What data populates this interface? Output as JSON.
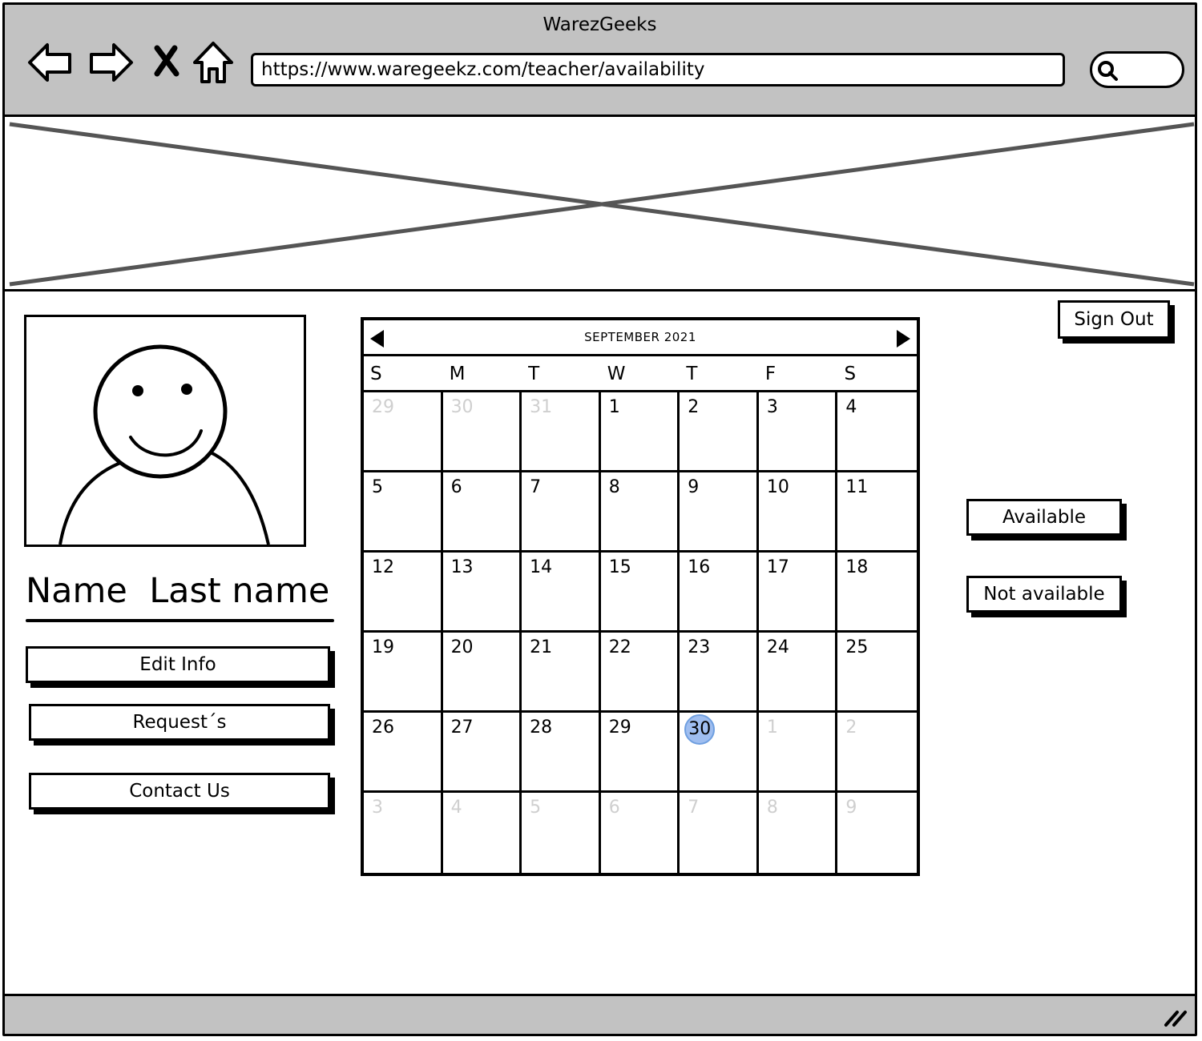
{
  "window": {
    "title": "WarezGeeks"
  },
  "browser": {
    "url": "https://www.waregeekz.com/teacher/availability",
    "nav_icons": [
      "back-arrow-icon",
      "forward-arrow-icon",
      "close-x-icon",
      "home-icon"
    ],
    "search_icon": "search-icon"
  },
  "banner": {
    "type": "image-placeholder"
  },
  "profile": {
    "avatar_icon": "user-avatar-icon",
    "name": "Name  Last name",
    "buttons": {
      "edit": "Edit Info",
      "requests": "Request´s",
      "contact": "Contact Us"
    }
  },
  "calendar": {
    "month_label": "SEPTEMBER 2021",
    "weekdays": [
      "S",
      "M",
      "T",
      "W",
      "T",
      "F",
      "S"
    ],
    "today": "30",
    "weeks": [
      [
        {
          "d": "29",
          "o": true
        },
        {
          "d": "30",
          "o": true
        },
        {
          "d": "31",
          "o": true
        },
        {
          "d": "1"
        },
        {
          "d": "2"
        },
        {
          "d": "3"
        },
        {
          "d": "4"
        }
      ],
      [
        {
          "d": "5"
        },
        {
          "d": "6"
        },
        {
          "d": "7"
        },
        {
          "d": "8"
        },
        {
          "d": "9"
        },
        {
          "d": "10"
        },
        {
          "d": "11"
        }
      ],
      [
        {
          "d": "12"
        },
        {
          "d": "13"
        },
        {
          "d": "14"
        },
        {
          "d": "15"
        },
        {
          "d": "16"
        },
        {
          "d": "17"
        },
        {
          "d": "18"
        }
      ],
      [
        {
          "d": "19"
        },
        {
          "d": "20"
        },
        {
          "d": "21"
        },
        {
          "d": "22"
        },
        {
          "d": "23"
        },
        {
          "d": "24"
        },
        {
          "d": "25"
        }
      ],
      [
        {
          "d": "26"
        },
        {
          "d": "27"
        },
        {
          "d": "28"
        },
        {
          "d": "29"
        },
        {
          "d": "30",
          "today": true
        },
        {
          "d": "1",
          "o": true
        },
        {
          "d": "2",
          "o": true
        }
      ],
      [
        {
          "d": "3",
          "o": true
        },
        {
          "d": "4",
          "o": true
        },
        {
          "d": "5",
          "o": true
        },
        {
          "d": "6",
          "o": true
        },
        {
          "d": "7",
          "o": true
        },
        {
          "d": "8",
          "o": true
        },
        {
          "d": "9",
          "o": true
        }
      ]
    ]
  },
  "actions": {
    "sign_out": "Sign Out",
    "available": "Available",
    "not_available": "Not available"
  },
  "colors": {
    "chrome": "#c2c2c2",
    "today_highlight": "#9fbef0",
    "muted_day": "#cfcfcf"
  }
}
